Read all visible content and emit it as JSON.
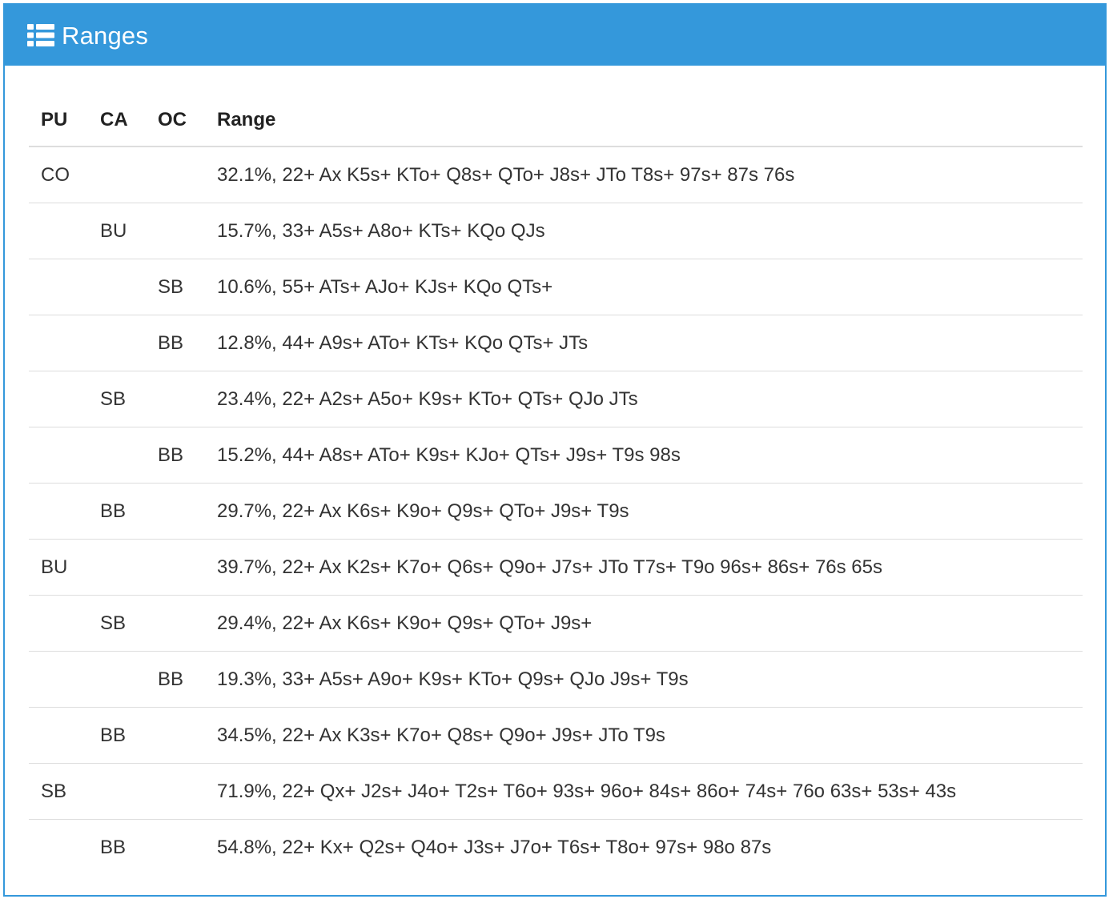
{
  "header": {
    "icon": "list-icon",
    "title": "Ranges"
  },
  "colors": {
    "accent": "#3498db"
  },
  "table": {
    "columns": [
      "PU",
      "CA",
      "OC",
      "Range"
    ],
    "rows": [
      {
        "pu": "CO",
        "ca": "",
        "oc": "",
        "range": "32.1%, 22+ Ax K5s+ KTo+ Q8s+ QTo+ J8s+ JTo T8s+ 97s+ 87s 76s"
      },
      {
        "pu": "",
        "ca": "BU",
        "oc": "",
        "range": "15.7%, 33+ A5s+ A8o+ KTs+ KQo QJs"
      },
      {
        "pu": "",
        "ca": "",
        "oc": "SB",
        "range": "10.6%, 55+ ATs+ AJo+ KJs+ KQo QTs+"
      },
      {
        "pu": "",
        "ca": "",
        "oc": "BB",
        "range": "12.8%, 44+ A9s+ ATo+ KTs+ KQo QTs+ JTs"
      },
      {
        "pu": "",
        "ca": "SB",
        "oc": "",
        "range": "23.4%, 22+ A2s+ A5o+ K9s+ KTo+ QTs+ QJo JTs"
      },
      {
        "pu": "",
        "ca": "",
        "oc": "BB",
        "range": "15.2%, 44+ A8s+ ATo+ K9s+ KJo+ QTs+ J9s+ T9s 98s"
      },
      {
        "pu": "",
        "ca": "BB",
        "oc": "",
        "range": "29.7%, 22+ Ax K6s+ K9o+ Q9s+ QTo+ J9s+ T9s"
      },
      {
        "pu": "BU",
        "ca": "",
        "oc": "",
        "range": "39.7%, 22+ Ax K2s+ K7o+ Q6s+ Q9o+ J7s+ JTo T7s+ T9o 96s+ 86s+ 76s 65s"
      },
      {
        "pu": "",
        "ca": "SB",
        "oc": "",
        "range": "29.4%, 22+ Ax K6s+ K9o+ Q9s+ QTo+ J9s+"
      },
      {
        "pu": "",
        "ca": "",
        "oc": "BB",
        "range": "19.3%, 33+ A5s+ A9o+ K9s+ KTo+ Q9s+ QJo J9s+ T9s"
      },
      {
        "pu": "",
        "ca": "BB",
        "oc": "",
        "range": "34.5%, 22+ Ax K3s+ K7o+ Q8s+ Q9o+ J9s+ JTo T9s"
      },
      {
        "pu": "SB",
        "ca": "",
        "oc": "",
        "range": "71.9%, 22+ Qx+ J2s+ J4o+ T2s+ T6o+ 93s+ 96o+ 84s+ 86o+ 74s+ 76o 63s+ 53s+ 43s"
      },
      {
        "pu": "",
        "ca": "BB",
        "oc": "",
        "range": "54.8%, 22+ Kx+ Q2s+ Q4o+ J3s+ J7o+ T6s+ T8o+ 97s+ 98o 87s"
      }
    ]
  }
}
